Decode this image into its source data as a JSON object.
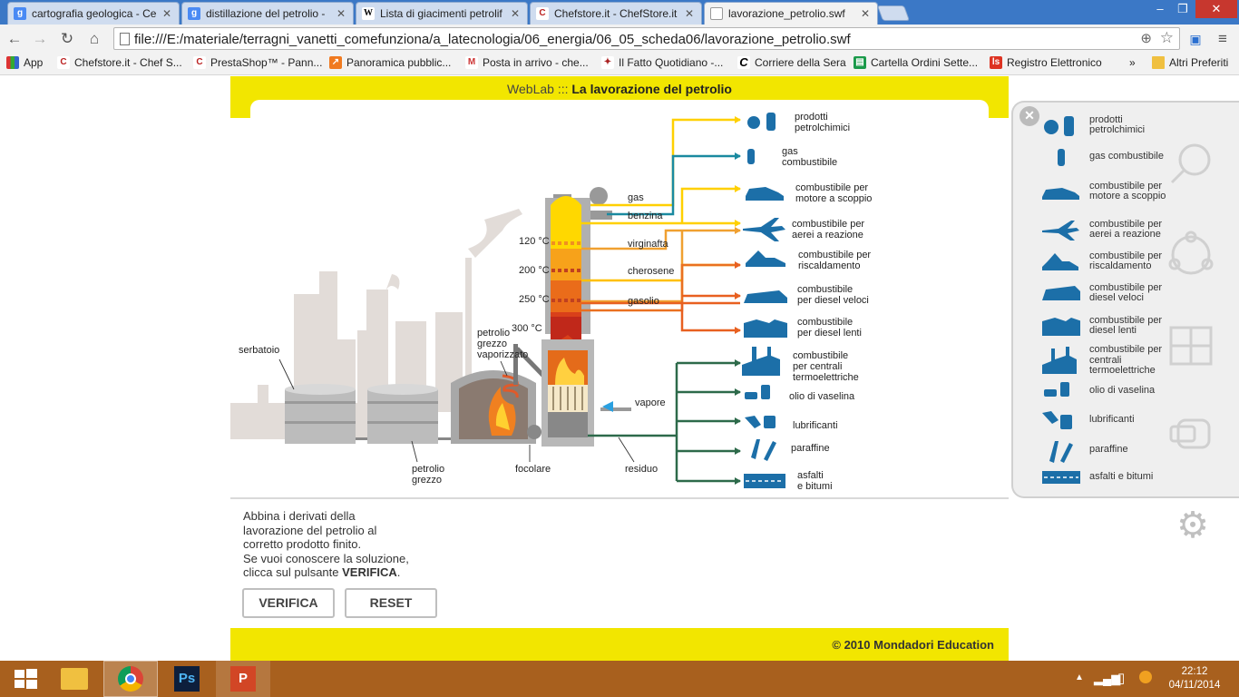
{
  "browser": {
    "tabs": [
      {
        "title": "cartografia geologica - Ce",
        "favicon": "google-icon"
      },
      {
        "title": "distillazione del petrolio -",
        "favicon": "google-icon"
      },
      {
        "title": "Lista di giacimenti petrolif",
        "favicon": "wikipedia-icon"
      },
      {
        "title": "Chefstore.it - ChefStore.it",
        "favicon": "chefstore-icon"
      },
      {
        "title": "lavorazione_petrolio.swf",
        "favicon": "page-icon"
      }
    ],
    "url": "file:///E:/materiale/terragni_vanetti_comefunziona/a_latecnologia/06_energia/06_05_scheda06/lavorazione_petrolio.swf",
    "bookmarks": [
      {
        "label": "App"
      },
      {
        "label": "Chefstore.it - Chef S..."
      },
      {
        "label": "PrestaShop™ - Pann..."
      },
      {
        "label": "Panoramica pubblic..."
      },
      {
        "label": "Posta in arrivo - che..."
      },
      {
        "label": "Il Fatto Quotidiano -..."
      },
      {
        "label": "Corriere della Sera"
      },
      {
        "label": "Cartella Ordini Sette..."
      },
      {
        "label": "Registro Elettronico"
      }
    ],
    "bookmarks_more": "»",
    "other_bookmarks": "Altri Preferiti"
  },
  "app": {
    "title_prefix": "WebLab :::",
    "title": "La lavorazione del petrolio",
    "diagram": {
      "temps": [
        "120 °C",
        "200 °C",
        "250 °C",
        "300 °C"
      ],
      "fractions": [
        "gas",
        "benzina",
        "virginafta",
        "cherosene",
        "gasolio"
      ],
      "labels": {
        "serbatoio": "serbatoio",
        "petrolio_vap": [
          "petrolio",
          "grezzo",
          "vaporizzato"
        ],
        "vapore": "vapore",
        "petrolio_grezzo": [
          "petrolio",
          "grezzo"
        ],
        "focolare": "focolare",
        "residuo": "residuo"
      },
      "products": [
        [
          "prodotti",
          "petrolchimici"
        ],
        [
          "gas",
          "combustibile"
        ],
        [
          "combustibile per",
          "motore a scoppio"
        ],
        [
          "combustibile per",
          "aerei a reazione"
        ],
        [
          "combustibile per",
          "riscaldamento"
        ],
        [
          "combustibile",
          "per diesel veloci"
        ],
        [
          "combustibile",
          "per diesel lenti"
        ],
        [
          "combustibile",
          "per centrali",
          "termoelettriche"
        ],
        [
          "olio di vaselina"
        ],
        [
          "lubrificanti"
        ],
        [
          "paraffine"
        ],
        [
          "asfalti",
          "e bitumi"
        ]
      ]
    },
    "instructions": [
      "Abbina i derivati della",
      "lavorazione del petrolio al",
      "corretto prodotto finito.",
      "Se vuoi conoscere la soluzione,",
      "clicca sul pulsante "
    ],
    "instructions_bold": "VERIFICA",
    "instructions_end": ".",
    "verify_label": "VERIFICA",
    "reset_label": "RESET",
    "copyright": "© 2010 Mondadori Education"
  },
  "side_panel": {
    "items": [
      {
        "label": "prodotti petrolchimici",
        "icon": "chemical-products-icon"
      },
      {
        "label": "gas combustibile",
        "icon": "gas-bottle-icon"
      },
      {
        "label": "combustibile per motore a scoppio",
        "icon": "car-icon"
      },
      {
        "label": "combustibile per aerei a reazione",
        "icon": "airplane-icon"
      },
      {
        "label": "combustibile per riscaldamento",
        "icon": "house-icon"
      },
      {
        "label": "combustibile per diesel veloci",
        "icon": "fast-train-icon"
      },
      {
        "label": "combustibile per diesel lenti",
        "icon": "ship-icon"
      },
      {
        "label": "combustibile per centrali termoelettriche",
        "icon": "power-plant-icon"
      },
      {
        "label": "olio di vaselina",
        "icon": "vaseline-icon"
      },
      {
        "label": "lubrificanti",
        "icon": "oil-can-icon"
      },
      {
        "label": "paraffine",
        "icon": "candles-icon"
      },
      {
        "label": "asfalti e bitumi",
        "icon": "road-icon"
      }
    ]
  },
  "taskbar": {
    "time": "22:12",
    "date": "04/11/2014"
  },
  "colors": {
    "accent_yellow": "#f2e600",
    "icon_blue": "#1c6fa8",
    "taskbar": "#a8601e",
    "line_yellow": "#ffd000",
    "line_orange": "#f0a030",
    "line_red": "#e86020",
    "line_teal": "#1a8aa0",
    "line_green": "#2d6a4a"
  }
}
